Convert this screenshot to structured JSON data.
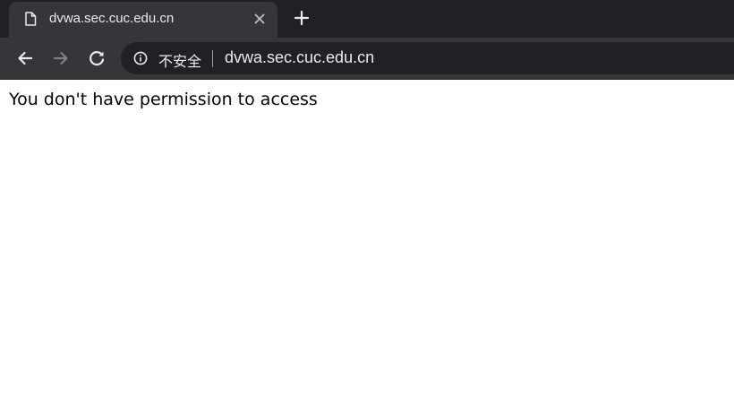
{
  "tab": {
    "title": "dvwa.sec.cuc.edu.cn",
    "favicon_icon": "document-icon",
    "close_icon": "close-icon"
  },
  "tabstrip": {
    "new_tab_icon": "plus-icon"
  },
  "toolbar": {
    "back_icon": "arrow-left-icon",
    "forward_icon": "arrow-right-icon",
    "reload_icon": "reload-icon"
  },
  "omnibox": {
    "security_icon": "info-icon",
    "security_label": "不安全",
    "url": "dvwa.sec.cuc.edu.cn"
  },
  "page": {
    "message": "You don't have permission to access"
  },
  "colors": {
    "tabstrip_bg": "#202124",
    "active_tab_bg": "#35363a",
    "omnibox_bg": "#202124",
    "toolbar_icon": "#e8eaed",
    "disabled_icon": "#7f8184",
    "page_bg": "#ffffff"
  }
}
